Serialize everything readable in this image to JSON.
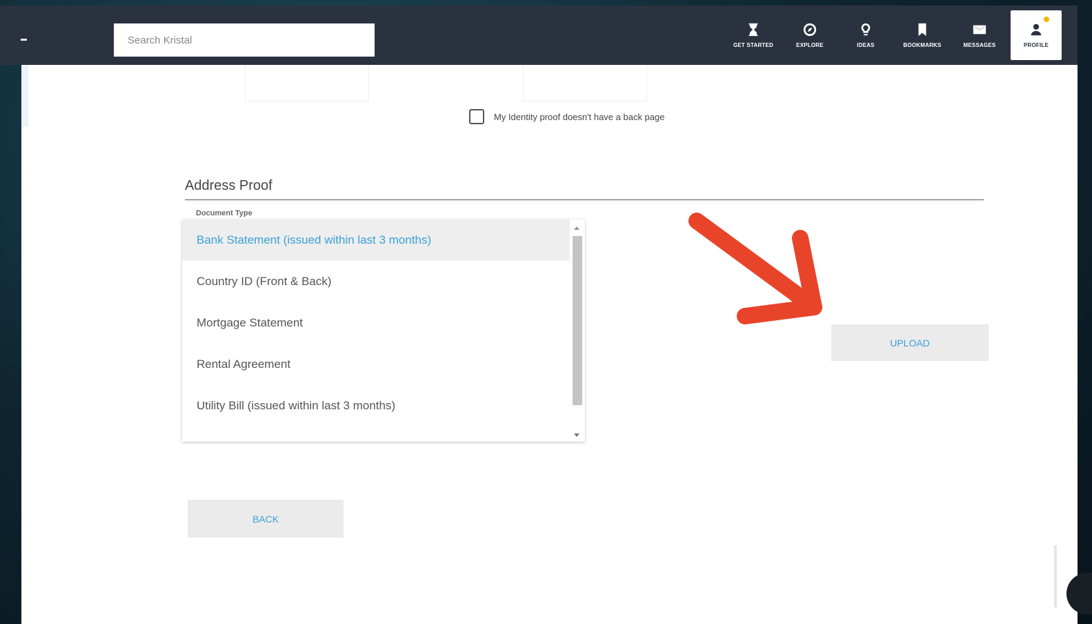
{
  "header": {
    "search_placeholder": "Search Kristal",
    "nav": [
      {
        "label": "GET STARTED",
        "icon": "hourglass-icon"
      },
      {
        "label": "EXPLORE",
        "icon": "compass-icon"
      },
      {
        "label": "IDEAS",
        "icon": "lightbulb-icon"
      },
      {
        "label": "BOOKMARKS",
        "icon": "bookmark-icon"
      },
      {
        "label": "MESSAGES",
        "icon": "envelope-icon"
      },
      {
        "label": "PROFILE",
        "icon": "user-icon"
      }
    ],
    "badge_color": "#f2b705"
  },
  "identity": {
    "no_back_page_label": "My Identity proof doesn't have a back page",
    "no_back_page_checked": false
  },
  "address_proof": {
    "title": "Address Proof",
    "field_label": "Document Type",
    "options": [
      "Bank Statement (issued within last 3 months)",
      "Country ID (Front & Back)",
      "Mortgage Statement",
      "Rental Agreement",
      "Utility Bill (issued within last 3 months)"
    ],
    "selected_index": 0,
    "upload_label": "UPLOAD"
  },
  "footer": {
    "back_label": "BACK"
  },
  "colors": {
    "header_bg": "#2b323f",
    "accent": "#3aa0d8",
    "annotation_arrow": "#e8442a"
  }
}
